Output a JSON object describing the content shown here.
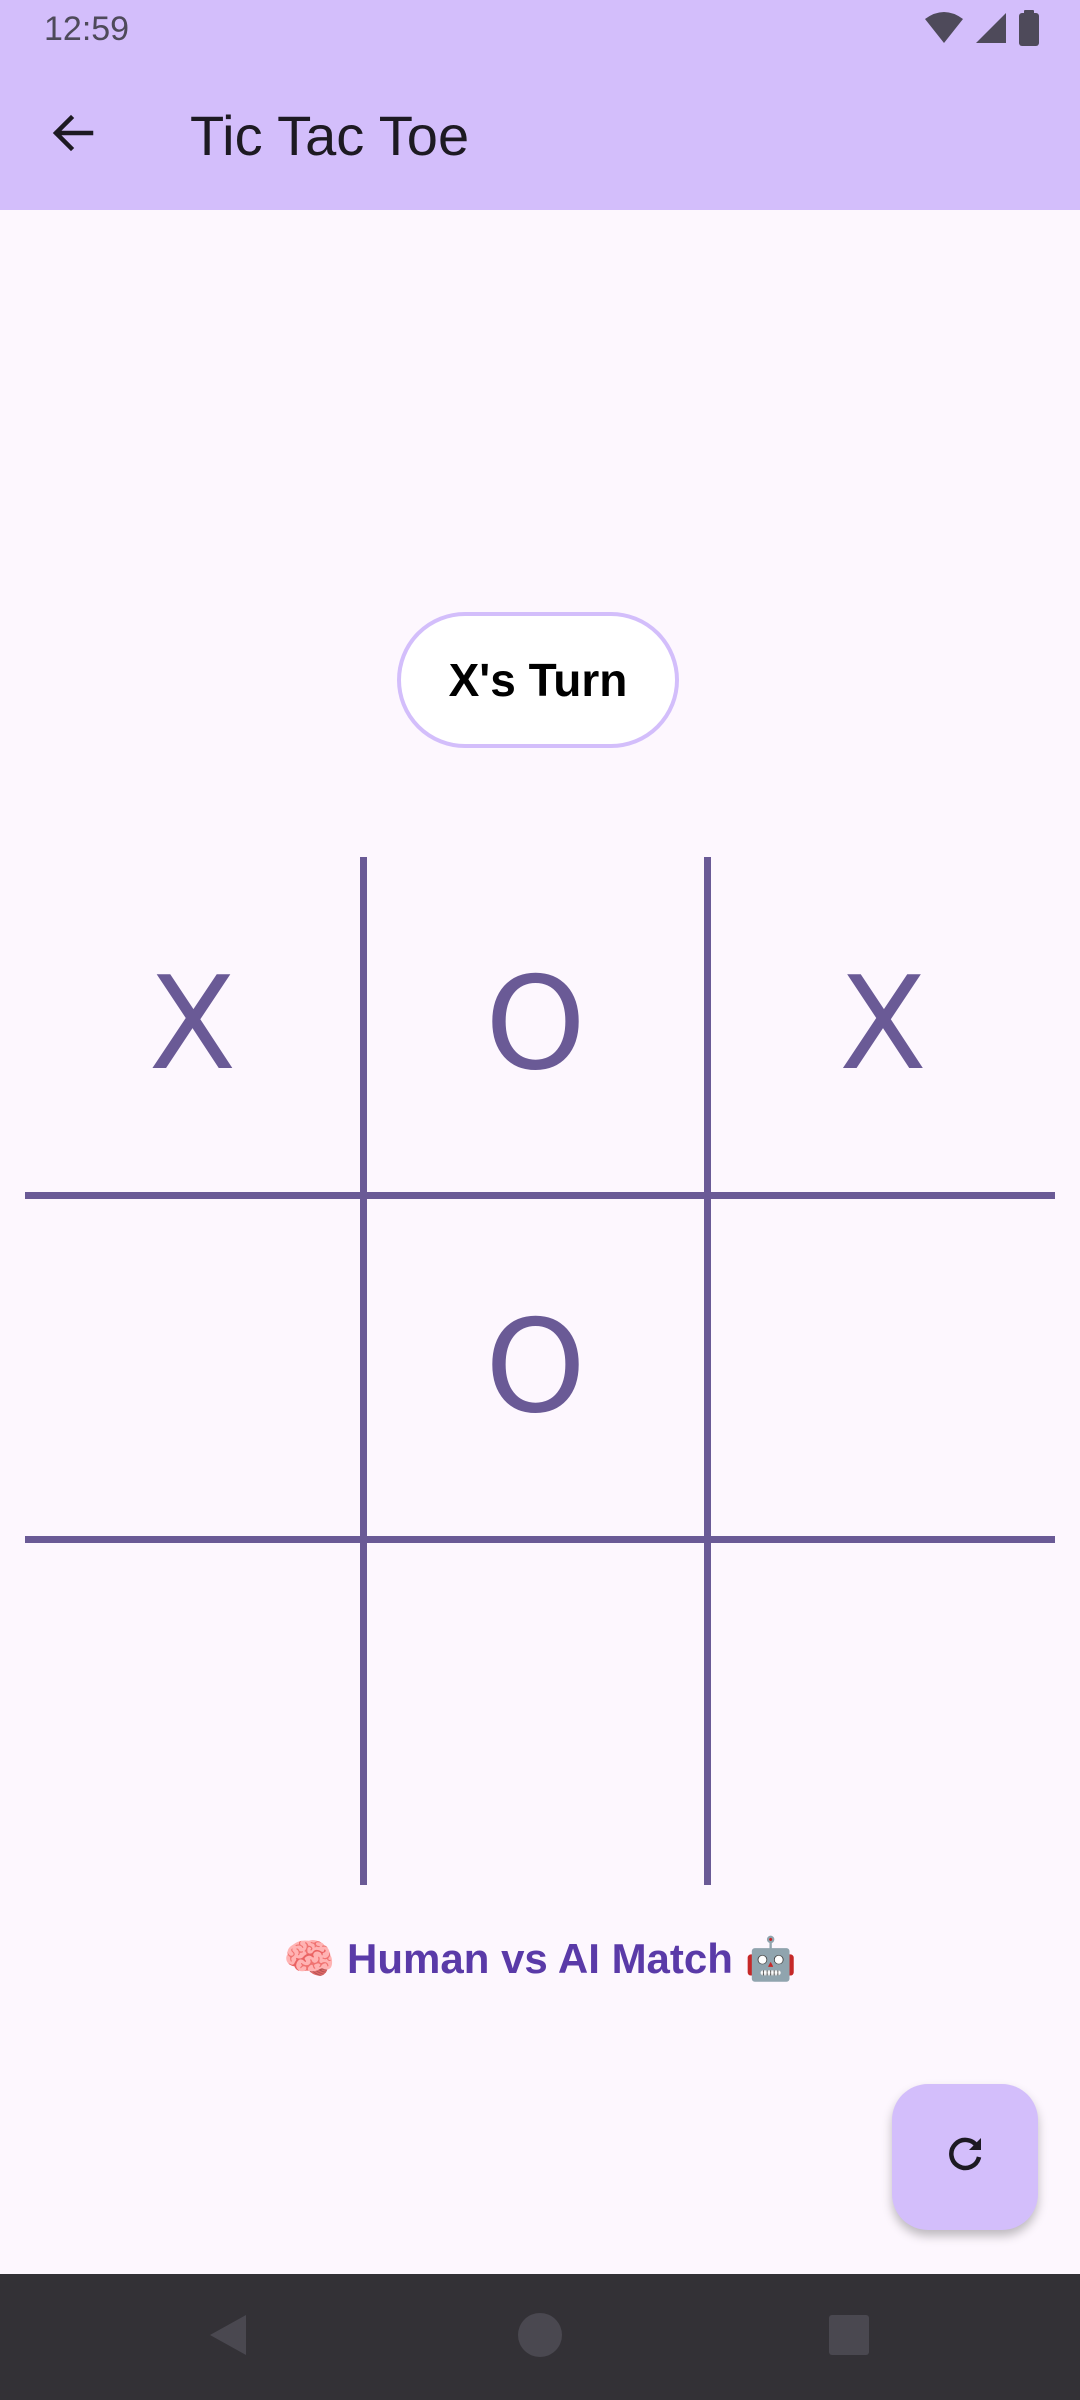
{
  "status_bar": {
    "time": "12:59",
    "icons": [
      "wifi-icon",
      "signal-icon",
      "battery-icon"
    ]
  },
  "app_bar": {
    "title": "Tic Tac Toe",
    "back_icon": "arrow-back-icon"
  },
  "game": {
    "turn_label": "X's Turn",
    "board": [
      "X",
      "O",
      "X",
      "",
      "O",
      "",
      "",
      "",
      ""
    ],
    "match_label": "🧠 Human vs AI Match 🤖"
  },
  "fab": {
    "icon": "refresh-icon"
  },
  "nav_bar": {
    "icons": [
      "nav-back-icon",
      "nav-home-icon",
      "nav-recents-icon"
    ]
  },
  "colors": {
    "app_bar": "#D3BEFB",
    "background": "#FDF7FE",
    "grid": "#6A5A96",
    "match_label": "#5A3AA8",
    "nav_bar": "#333136"
  }
}
